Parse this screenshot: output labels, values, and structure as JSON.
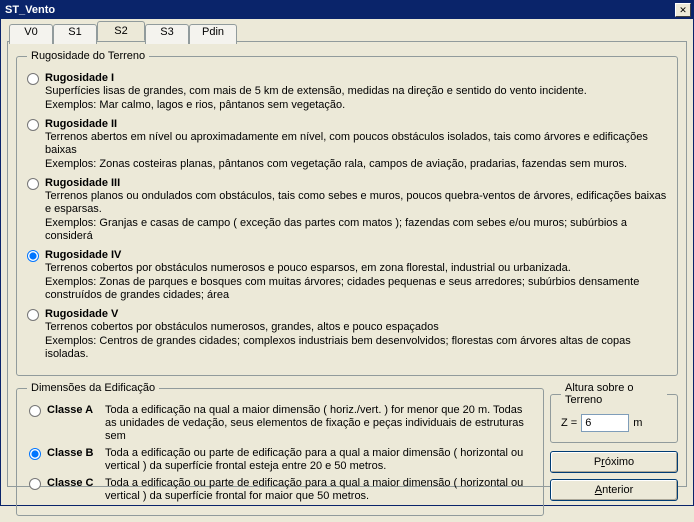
{
  "window": {
    "title": "ST_Vento"
  },
  "tabs": {
    "t0": "V0",
    "t1": "S1",
    "t2": "S2",
    "t3": "S3",
    "t4": "Pdin"
  },
  "rug": {
    "legend": "Rugosidade do Terreno",
    "r1": {
      "title": "Rugosidade I",
      "l1": "Superfícies lisas de grandes, com mais de 5 km de extensão, medidas na direção e sentido do vento incidente.",
      "l2": "Exemplos: Mar calmo, lagos e rios, pântanos sem vegetação."
    },
    "r2": {
      "title": "Rugosidade II",
      "l1": "Terrenos abertos em nível ou aproximadamente em nível, com poucos obstáculos isolados, tais como árvores e edificações baixas",
      "l2": "Exemplos: Zonas costeiras planas, pântanos com vegetação rala, campos de aviação, pradarias, fazendas sem muros."
    },
    "r3": {
      "title": "Rugosidade III",
      "l1": "Terrenos planos ou ondulados com obstáculos, tais como sebes e muros, poucos quebra-ventos de árvores, edificações baixas e esparsas.",
      "l2": "Exemplos: Granjas e casas de campo ( exceção das partes com matos ); fazendas com sebes e/ou muros; subúrbios a considerá"
    },
    "r4": {
      "title": "Rugosidade IV",
      "l1": "Terrenos cobertos por obstáculos numerosos e pouco esparsos, em zona florestal, industrial ou urbanizada.",
      "l2": "Exemplos: Zonas de parques e bosques com muitas árvores; cidades pequenas e seus arredores; subúrbios densamente construídos de grandes cidades; área"
    },
    "r5": {
      "title": "Rugosidade V",
      "l1": "Terrenos cobertos por obstáculos numerosos, grandes, altos e pouco espaçados",
      "l2": "Exemplos: Centros de grandes cidades; complexos industriais bem desenvolvidos; florestas com árvores altas de copas isoladas."
    }
  },
  "dim": {
    "legend": "Dimensões da Edificação",
    "a": {
      "title": "Classe A",
      "desc": "Toda a edificação na qual a maior dimensão ( horiz./vert. ) for menor que 20 m. Todas as unidades de vedação, seus elementos de fixação e peças individuais de estruturas sem"
    },
    "b": {
      "title": "Classe B",
      "desc": "Toda a edificação ou parte de edificação para a qual a maior dimensão ( horizontal ou vertical ) da superfície frontal esteja entre 20 e 50 metros."
    },
    "c": {
      "title": "Classe C",
      "desc": "Toda a edificação ou parte de edificação para a qual a maior dimensão ( horizontal ou vertical ) da superfície frontal for maior que 50 metros."
    }
  },
  "altura": {
    "legend": "Altura sobre o Terreno",
    "z_label": "Z =",
    "z_value": "6",
    "unit": "m"
  },
  "buttons": {
    "next_pre": "P",
    "next_u": "r",
    "next_post": "óximo",
    "prev_pre": "",
    "prev_u": "A",
    "prev_post": "nterior"
  }
}
